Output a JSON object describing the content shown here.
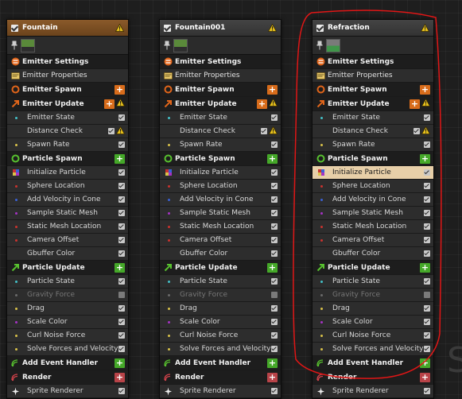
{
  "colors": {
    "header_orange": "#7a4e25",
    "header_gray": "#3b3b3b",
    "header_red_tint": "#4a3a2a",
    "selected_row": "#e7cfa8",
    "highlight_circle": "#e01616",
    "spawn_orange": "#d86c1b",
    "particle_green": "#45a829",
    "render_red": "#b84348"
  },
  "background_letter": "S",
  "emitters": [
    {
      "title": "Fountain",
      "header_variant": "orange",
      "has_warning": true,
      "thumbnail_selected": false,
      "rows": [
        {
          "label": "Emitter Settings",
          "kind": "section",
          "icon": "emitter-settings-icon"
        },
        {
          "label": "Emitter Properties",
          "kind": "props",
          "icon": "emitter-properties-icon"
        },
        {
          "label": "Emitter Spawn",
          "kind": "group",
          "icon": "emitter-spawn-icon",
          "add": "orange"
        },
        {
          "label": "Emitter Update",
          "kind": "group",
          "icon": "emitter-update-icon",
          "add": "orange",
          "warn": true
        },
        {
          "label": "Emitter State",
          "kind": "item",
          "dot": "#44c1c8",
          "checked": true
        },
        {
          "label": "Distance Check",
          "kind": "item",
          "dot": "",
          "checked": true,
          "warn": true
        },
        {
          "label": "Spawn Rate",
          "kind": "item",
          "dot": "#d9c24a",
          "checked": true
        },
        {
          "label": "Particle Spawn",
          "kind": "group",
          "icon": "particle-spawn-icon",
          "add": "green"
        },
        {
          "label": "Initialize Particle",
          "kind": "item",
          "dot": "multi",
          "checked": true
        },
        {
          "label": "Sphere Location",
          "kind": "item",
          "dot": "#c9332f",
          "checked": true
        },
        {
          "label": "Add Velocity in Cone",
          "kind": "item",
          "dot": "#3a61d4",
          "checked": true
        },
        {
          "label": "Sample Static Mesh",
          "kind": "item",
          "dot": "#a533c4",
          "checked": true
        },
        {
          "label": "Static Mesh Location",
          "kind": "item",
          "dot": "#c9332f",
          "checked": true
        },
        {
          "label": "Camera Offset",
          "kind": "item",
          "dot": "#c9332f",
          "checked": true
        },
        {
          "label": "Gbuffer Color",
          "kind": "item",
          "dot": "",
          "checked": true
        },
        {
          "label": "Particle Update",
          "kind": "group",
          "icon": "particle-update-icon",
          "add": "green"
        },
        {
          "label": "Particle State",
          "kind": "item",
          "dot": "#44c1c8",
          "checked": true
        },
        {
          "label": "Gravity Force",
          "kind": "item",
          "dot": "#6a6a6a",
          "checked": false,
          "disabled": true
        },
        {
          "label": "Drag",
          "kind": "item",
          "dot": "#d9c24a",
          "checked": true
        },
        {
          "label": "Scale Color",
          "kind": "item",
          "dot": "#a533c4",
          "checked": true
        },
        {
          "label": "Curl Noise Force",
          "kind": "item",
          "dot": "#d9c24a",
          "checked": true
        },
        {
          "label": "Solve Forces and Velocity",
          "kind": "item",
          "dot": "#d9c24a",
          "checked": true
        },
        {
          "label": "Add Event Handler",
          "kind": "group",
          "icon": "event-handler-icon",
          "add": "green"
        },
        {
          "label": "Render",
          "kind": "group",
          "icon": "render-icon",
          "add": "red"
        },
        {
          "label": "Sprite Renderer",
          "kind": "item",
          "icon": "sprite-icon",
          "checked": true
        }
      ]
    },
    {
      "title": "Fountain001",
      "header_variant": "gray",
      "has_warning": true,
      "thumbnail_selected": false,
      "rows": [
        {
          "label": "Emitter Settings",
          "kind": "section",
          "icon": "emitter-settings-icon"
        },
        {
          "label": "Emitter Properties",
          "kind": "props",
          "icon": "emitter-properties-icon"
        },
        {
          "label": "Emitter Spawn",
          "kind": "group",
          "icon": "emitter-spawn-icon",
          "add": "orange"
        },
        {
          "label": "Emitter Update",
          "kind": "group",
          "icon": "emitter-update-icon",
          "add": "orange",
          "warn": true
        },
        {
          "label": "Emitter State",
          "kind": "item",
          "dot": "#44c1c8",
          "checked": true
        },
        {
          "label": "Distance Check",
          "kind": "item",
          "dot": "",
          "checked": true,
          "warn": true
        },
        {
          "label": "Spawn Rate",
          "kind": "item",
          "dot": "#d9c24a",
          "checked": true
        },
        {
          "label": "Particle Spawn",
          "kind": "group",
          "icon": "particle-spawn-icon",
          "add": "green"
        },
        {
          "label": "Initialize Particle",
          "kind": "item",
          "dot": "multi",
          "checked": true
        },
        {
          "label": "Sphere Location",
          "kind": "item",
          "dot": "#c9332f",
          "checked": true
        },
        {
          "label": "Add Velocity in Cone",
          "kind": "item",
          "dot": "#3a61d4",
          "checked": true
        },
        {
          "label": "Sample Static Mesh",
          "kind": "item",
          "dot": "#a533c4",
          "checked": true
        },
        {
          "label": "Static Mesh Location",
          "kind": "item",
          "dot": "#c9332f",
          "checked": true
        },
        {
          "label": "Camera Offset",
          "kind": "item",
          "dot": "#c9332f",
          "checked": true
        },
        {
          "label": "Gbuffer Color",
          "kind": "item",
          "dot": "",
          "checked": true
        },
        {
          "label": "Particle Update",
          "kind": "group",
          "icon": "particle-update-icon",
          "add": "green"
        },
        {
          "label": "Particle State",
          "kind": "item",
          "dot": "#44c1c8",
          "checked": true
        },
        {
          "label": "Gravity Force",
          "kind": "item",
          "dot": "#6a6a6a",
          "checked": false,
          "disabled": true
        },
        {
          "label": "Drag",
          "kind": "item",
          "dot": "#d9c24a",
          "checked": true
        },
        {
          "label": "Scale Color",
          "kind": "item",
          "dot": "#a533c4",
          "checked": true
        },
        {
          "label": "Curl Noise Force",
          "kind": "item",
          "dot": "#d9c24a",
          "checked": true
        },
        {
          "label": "Solve Forces and Velocity",
          "kind": "item",
          "dot": "#d9c24a",
          "checked": true
        },
        {
          "label": "Add Event Handler",
          "kind": "group",
          "icon": "event-handler-icon",
          "add": "green"
        },
        {
          "label": "Render",
          "kind": "group",
          "icon": "render-icon",
          "add": "red"
        },
        {
          "label": "Sprite Renderer",
          "kind": "item",
          "icon": "sprite-icon",
          "checked": true
        }
      ]
    },
    {
      "title": "Refraction",
      "header_variant": "gray",
      "has_warning": true,
      "thumbnail_selected": true,
      "rows": [
        {
          "label": "Emitter Settings",
          "kind": "section",
          "icon": "emitter-settings-icon"
        },
        {
          "label": "Emitter Properties",
          "kind": "props",
          "icon": "emitter-properties-icon"
        },
        {
          "label": "Emitter Spawn",
          "kind": "group",
          "icon": "emitter-spawn-icon",
          "add": "orange"
        },
        {
          "label": "Emitter Update",
          "kind": "group",
          "icon": "emitter-update-icon",
          "add": "orange",
          "warn": true
        },
        {
          "label": "Emitter State",
          "kind": "item",
          "dot": "#44c1c8",
          "checked": true
        },
        {
          "label": "Distance Check",
          "kind": "item",
          "dot": "",
          "checked": true,
          "warn": true
        },
        {
          "label": "Spawn Rate",
          "kind": "item",
          "dot": "#d9c24a",
          "checked": true
        },
        {
          "label": "Particle Spawn",
          "kind": "group",
          "icon": "particle-spawn-icon",
          "add": "green"
        },
        {
          "label": "Initialize Particle",
          "kind": "item",
          "dot": "multi",
          "checked": true,
          "selected": true
        },
        {
          "label": "Sphere Location",
          "kind": "item",
          "dot": "#c9332f",
          "checked": true
        },
        {
          "label": "Add Velocity in Cone",
          "kind": "item",
          "dot": "#3a61d4",
          "checked": true
        },
        {
          "label": "Sample Static Mesh",
          "kind": "item",
          "dot": "#a533c4",
          "checked": true
        },
        {
          "label": "Static Mesh Location",
          "kind": "item",
          "dot": "#c9332f",
          "checked": true
        },
        {
          "label": "Camera Offset",
          "kind": "item",
          "dot": "#c9332f",
          "checked": true
        },
        {
          "label": "Gbuffer Color",
          "kind": "item",
          "dot": "",
          "checked": true
        },
        {
          "label": "Particle Update",
          "kind": "group",
          "icon": "particle-update-icon",
          "add": "green"
        },
        {
          "label": "Particle State",
          "kind": "item",
          "dot": "#44c1c8",
          "checked": true
        },
        {
          "label": "Gravity Force",
          "kind": "item",
          "dot": "#6a6a6a",
          "checked": false,
          "disabled": true
        },
        {
          "label": "Drag",
          "kind": "item",
          "dot": "#d9c24a",
          "checked": true
        },
        {
          "label": "Scale Color",
          "kind": "item",
          "dot": "#a533c4",
          "checked": true
        },
        {
          "label": "Curl Noise Force",
          "kind": "item",
          "dot": "#d9c24a",
          "checked": true
        },
        {
          "label": "Solve Forces and Velocity",
          "kind": "item",
          "dot": "#d9c24a",
          "checked": true
        },
        {
          "label": "Add Event Handler",
          "kind": "group",
          "icon": "event-handler-icon",
          "add": "green"
        },
        {
          "label": "Render",
          "kind": "group",
          "icon": "render-icon",
          "add": "red"
        },
        {
          "label": "Sprite Renderer",
          "kind": "item",
          "icon": "sprite-icon",
          "checked": true
        }
      ]
    }
  ]
}
